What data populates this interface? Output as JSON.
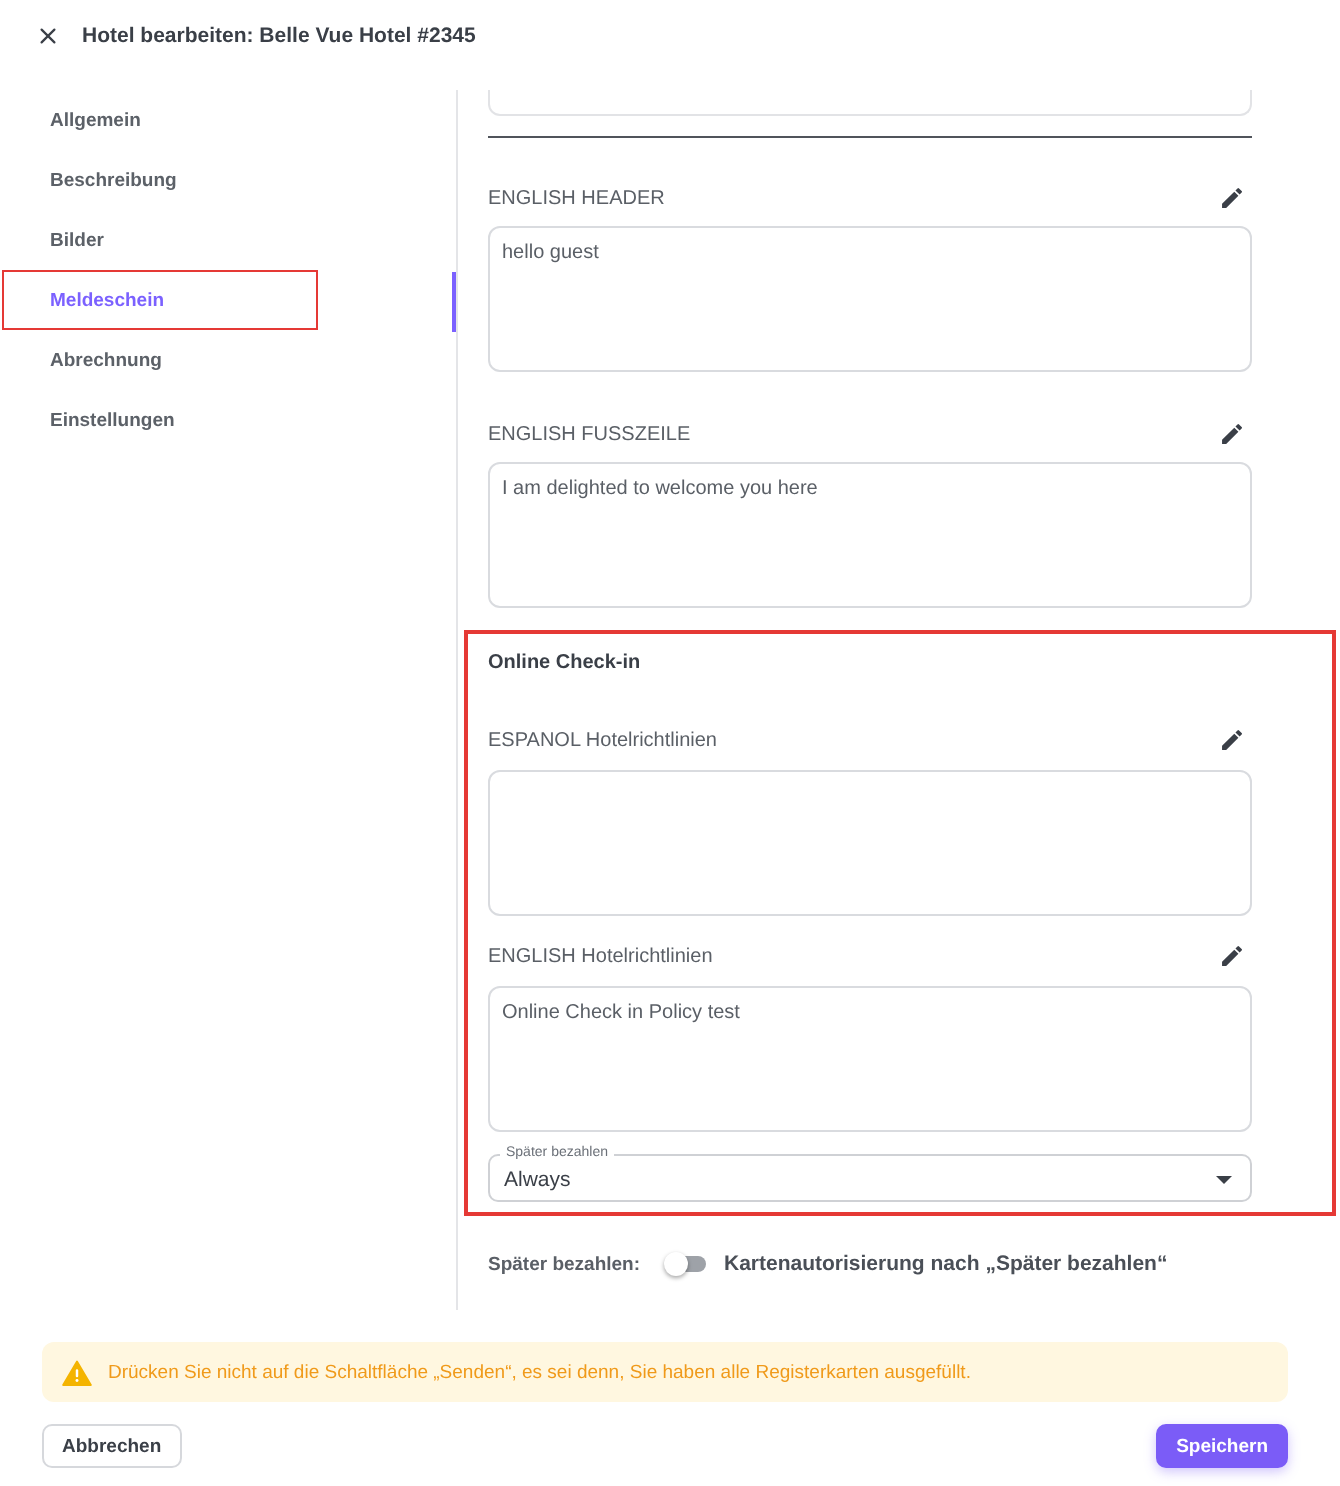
{
  "dialog": {
    "title": "Hotel bearbeiten: Belle Vue Hotel #2345"
  },
  "sidebar": {
    "items": [
      {
        "label": "Allgemein",
        "selected": false,
        "highlighted": false
      },
      {
        "label": "Beschreibung",
        "selected": false,
        "highlighted": false
      },
      {
        "label": "Bilder",
        "selected": false,
        "highlighted": false
      },
      {
        "label": "Meldeschein",
        "selected": true,
        "highlighted": true
      },
      {
        "label": "Abrechnung",
        "selected": false,
        "highlighted": false
      },
      {
        "label": "Einstellungen",
        "selected": false,
        "highlighted": false
      }
    ]
  },
  "form": {
    "blocks": [
      {
        "kind": "clipped"
      },
      {
        "kind": "divider"
      },
      {
        "kind": "textarea",
        "label": "ENGLISH HEADER",
        "value": "hello guest"
      },
      {
        "kind": "textarea",
        "label": "ENGLISH FUSSZEILE",
        "value": "I am delighted to welcome you here"
      }
    ]
  },
  "online_checkin": {
    "title": "Online Check-in",
    "highlighted": true,
    "blocks": [
      {
        "kind": "textarea",
        "label": "ESPANOL Hotelrichtlinien"
      },
      {
        "kind": "textarea",
        "label": "ENGLISH Hotelrichtlinien",
        "value": "Online Check in Policy test"
      },
      {
        "kind": "select",
        "label": "Später bezahlen",
        "value": "Always"
      }
    ]
  },
  "pay_later": {
    "label": "Später bezahlen:",
    "toggle": {
      "on": false,
      "label": "Kartenautorisierung nach „Später bezahlen“"
    }
  },
  "alert": {
    "kind": "warning",
    "text": "Drücken Sie nicht auf die Schaltfläche „Senden“, es sei denn, Sie haben alle Registerkarten ausgefüllt."
  },
  "buttons": [
    {
      "kind": "secondary",
      "label": "Abbrechen"
    },
    {
      "kind": "primary",
      "label": "Speichern"
    }
  ]
}
